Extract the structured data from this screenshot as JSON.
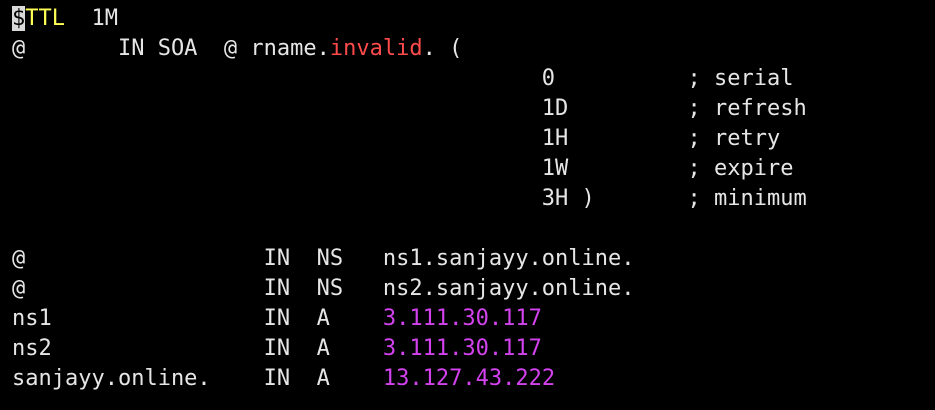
{
  "terminal": {
    "colors": {
      "background": "#000000",
      "text": "#e6e6e6",
      "cursor_bg": "#d9d9d9",
      "keyword": "#ffff55",
      "invalid": "#ff4b4b",
      "ip": "#d442f0"
    },
    "lines": [
      {
        "cursor_char": "$",
        "keyword": "TTL",
        "rest": "  1M"
      },
      {
        "prefix": "@       IN SOA  @ rname.",
        "invalid": "invalid",
        "suffix": ". ("
      },
      {
        "text": "                                        0          ; serial"
      },
      {
        "text": "                                        1D         ; refresh"
      },
      {
        "text": "                                        1H         ; retry"
      },
      {
        "text": "                                        1W         ; expire"
      },
      {
        "text": "                                        3H )       ; minimum"
      },
      {
        "text": ""
      },
      {
        "record": "@                  IN  NS   ns1.sanjayy.online."
      },
      {
        "record": "@                  IN  NS   ns2.sanjayy.online."
      },
      {
        "prefix": "ns1                IN  A    ",
        "ip": "3.111.30.117"
      },
      {
        "prefix": "ns2                IN  A    ",
        "ip": "3.111.30.117"
      },
      {
        "prefix": "sanjayy.online.    IN  A    ",
        "ip": "13.127.43.222"
      }
    ],
    "partial_line": "                                                             "
  }
}
